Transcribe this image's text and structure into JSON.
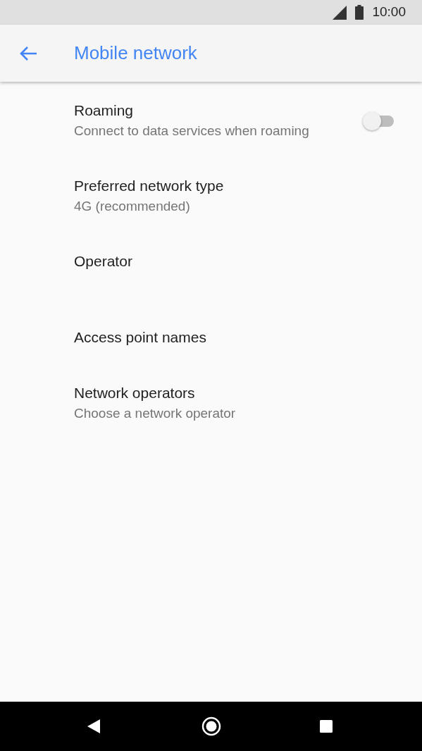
{
  "status_bar": {
    "time": "10:00"
  },
  "app_bar": {
    "title": "Mobile network"
  },
  "settings": [
    {
      "kind": "two-line",
      "title": "Roaming",
      "summary": "Connect to data services when roaming",
      "switch": {
        "on": false
      }
    },
    {
      "kind": "two-line",
      "title": "Preferred network type",
      "summary": "4G (recommended)"
    },
    {
      "kind": "two-line",
      "title": "Operator"
    },
    {
      "kind": "single-line",
      "title": "Access point names"
    },
    {
      "kind": "two-line",
      "title": "Network operators",
      "summary": "Choose a network operator"
    }
  ]
}
